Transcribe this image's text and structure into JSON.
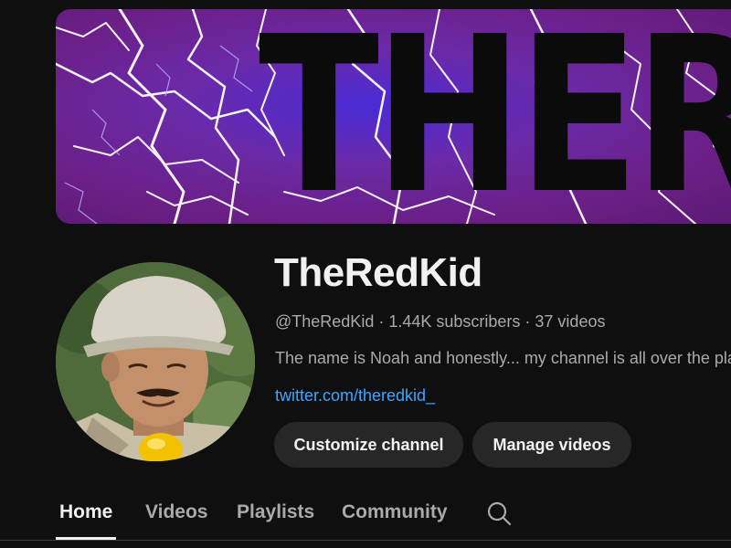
{
  "banner": {
    "text": "THERE",
    "colors": {
      "background": "#6b1f86",
      "glow": "#4a2bd6",
      "lightning": "#ffffff",
      "text": "#0b0b0b"
    }
  },
  "channel": {
    "name": "TheRedKid",
    "handle": "@TheRedKid",
    "subscribers": "1.44K subscribers",
    "videos": "37 videos",
    "separator": "·",
    "description": "The name is Noah and honestly... my channel is all over the place",
    "link": "twitter.com/theredkid_"
  },
  "buttons": {
    "customize": "Customize channel",
    "manage": "Manage videos"
  },
  "tabs": [
    {
      "label": "Home",
      "active": true
    },
    {
      "label": "Videos",
      "active": false
    },
    {
      "label": "Playlists",
      "active": false
    },
    {
      "label": "Community",
      "active": false
    }
  ],
  "icons": {
    "tab_search": "search-icon"
  },
  "colors": {
    "page_bg": "#0f0f0f",
    "text_primary": "#f1f1f1",
    "text_secondary": "#aaaaaa",
    "link": "#3ea6ff",
    "button_bg": "#272727"
  }
}
